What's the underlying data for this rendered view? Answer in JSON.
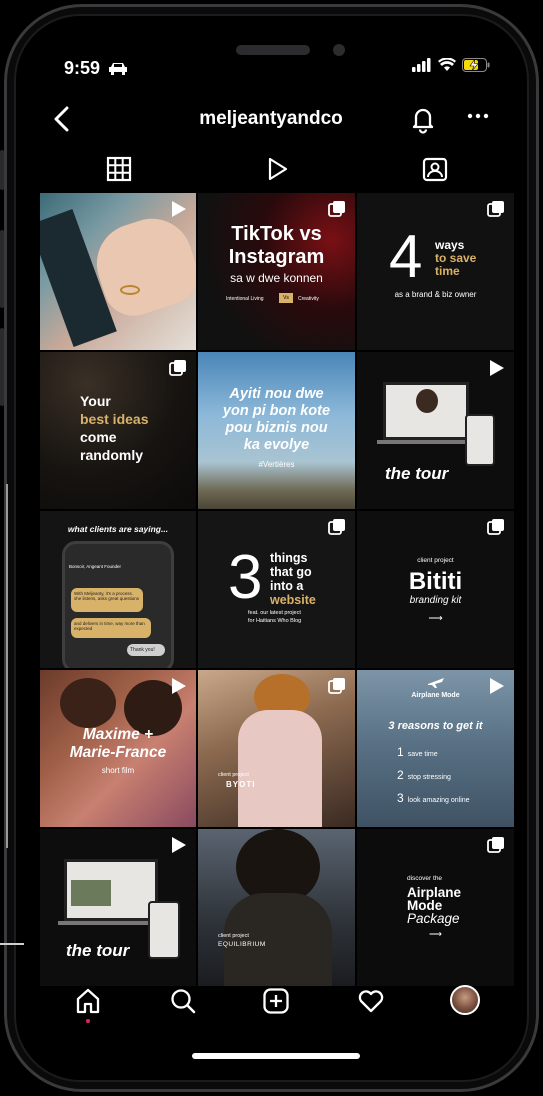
{
  "status": {
    "time": "9:59"
  },
  "header": {
    "username": "meljeantyandco"
  },
  "posts": {
    "tiktok": {
      "title1": "TikTok vs",
      "title2": "Instagram",
      "subtitle": "sa w dwe konnen",
      "tag_left": "Intentional Living",
      "tag_mid": "Vs",
      "tag_right": "Creativity"
    },
    "ways": {
      "number": "4",
      "line1": "ways",
      "line2": "to save",
      "line3": "time",
      "caption": "as a brand & biz owner"
    },
    "ideas": {
      "line1": "Your",
      "line2": "best ideas",
      "line3": "come",
      "line4": "randomly"
    },
    "ayiti": {
      "line1": "Ayiti nou dwe",
      "line2": "yon pi bon kote",
      "line3": "pou biznis nou",
      "line4": "ka evolye",
      "tag": "#Vertières"
    },
    "tour1": {
      "label": "the tour"
    },
    "clients": {
      "heading": "what clients are saying...",
      "name": "Bonsoir, Angeant Founder",
      "bubble1": "With Meljeanty, it's a process. she listens, asks great questions",
      "bubble2": "and delivers in time, way more than expected",
      "bubble3": "Thank you!"
    },
    "things": {
      "number": "3",
      "line1": "things",
      "line2": "that go",
      "line3": "into a",
      "line4": "website",
      "caption1": "feat. our latest project",
      "caption2": "for Haitians Who Blog"
    },
    "bititi": {
      "kicker": "client project",
      "title": "Bititi",
      "subtitle": "branding kit",
      "arrow": "⟶"
    },
    "maxime": {
      "line1": "Maxime +",
      "line2": "Marie-France",
      "subtitle": "short film"
    },
    "byoti": {
      "kicker": "client project",
      "brand": "BYOTI"
    },
    "airplane": {
      "title": "Airplane Mode",
      "kicker": "3 reasons to get it",
      "items": [
        "save time",
        "stop stressing",
        "look amazing online"
      ],
      "nums": [
        "1",
        "2",
        "3"
      ]
    },
    "tour2": {
      "label": "the tour"
    },
    "equilibrium": {
      "kicker": "client project",
      "brand": "EQUILIBRIUM"
    },
    "package": {
      "kicker": "discover the",
      "line1": "Airplane",
      "line2": "Mode",
      "line3": "Package",
      "arrow": "⟶"
    }
  },
  "colors": {
    "gold": "#d9b26a",
    "background": "#000000",
    "accent_red": "#e0245e"
  }
}
